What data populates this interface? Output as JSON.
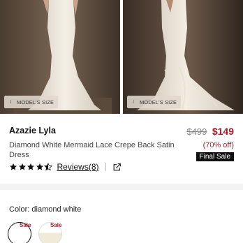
{
  "gallery": {
    "images": [
      {
        "tag": "MODEL'S SIZE"
      },
      {
        "tag": "MODEL'S SIZE"
      }
    ]
  },
  "product": {
    "brand": "Azazie Lyla",
    "subtitle": "Diamond White Mermaid Lace Crepe Back Satin Dress",
    "old_price": "$499",
    "new_price": "$149",
    "discount": "(70% off)",
    "final_sale": "Final Sale"
  },
  "rating": {
    "stars": 4.5,
    "reviews_label": "Reviews(8)"
  },
  "color": {
    "label": "Color: diamond white",
    "swatches": [
      {
        "badge": "Sale",
        "selected": true,
        "fill": "#ffffff"
      },
      {
        "badge": "Sale",
        "selected": false,
        "fill": "#f2ead8"
      }
    ]
  },
  "colors": {
    "accent": "#a0202a",
    "final_sale_bg": "#111111"
  }
}
